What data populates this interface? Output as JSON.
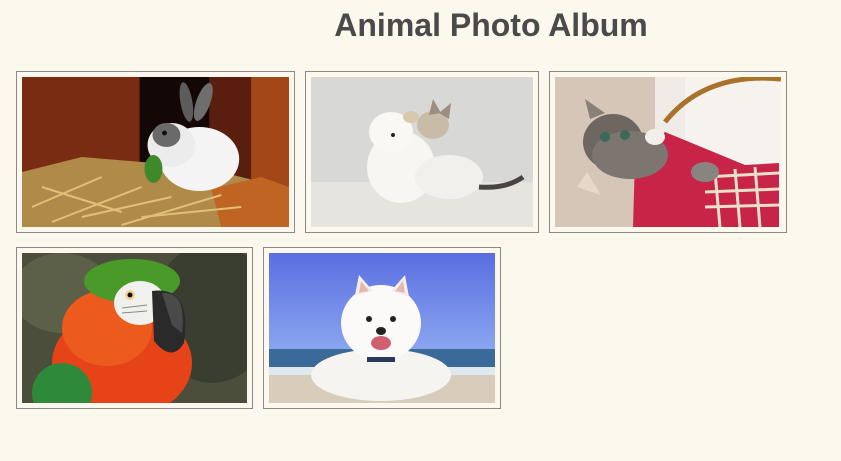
{
  "page": {
    "title": "Animal Photo Album"
  },
  "photos": [
    {
      "subject": "rabbit"
    },
    {
      "subject": "puppy-and-kitten"
    },
    {
      "subject": "kitten-in-basket"
    },
    {
      "subject": "parrot"
    },
    {
      "subject": "white-dog-on-beach"
    }
  ],
  "colors": {
    "background": "#fdf8ee",
    "title": "#4a4a4a",
    "frame_border": "#8a8a8a"
  }
}
